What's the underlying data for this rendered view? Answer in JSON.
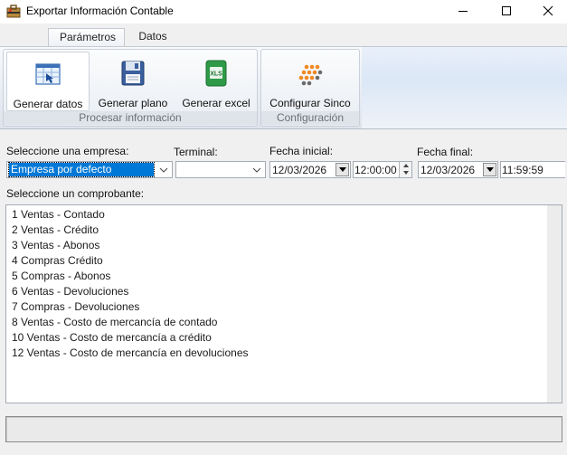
{
  "window": {
    "title": "Exportar Información Contable",
    "app_icon": "toolbox-icon",
    "controls": [
      "minimize-icon",
      "maximize-icon",
      "close-icon"
    ]
  },
  "ribbon": {
    "tabs": [
      {
        "label": "Parámetros",
        "active": true
      },
      {
        "label": "Datos",
        "active": false
      }
    ],
    "groups": [
      {
        "label": "Procesar información",
        "buttons": [
          {
            "label": "Generar datos",
            "icon": "spreadsheet-data-icon"
          },
          {
            "label": "Generar plano",
            "icon": "floppy-disk-icon"
          },
          {
            "label": "Generar excel",
            "icon": "xls-file-icon"
          }
        ]
      },
      {
        "label": "Configuración",
        "buttons": [
          {
            "label": "Configurar Sinco",
            "icon": "sinco-logo-icon"
          }
        ]
      }
    ]
  },
  "form": {
    "empresa_label": "Seleccione una empresa:",
    "empresa_value": "Empresa por defecto",
    "terminal_label": "Terminal:",
    "terminal_value": "",
    "fecha_inicial_label": "Fecha inicial:",
    "fecha_inicial_date": "12/03/2026",
    "fecha_inicial_time": "12:00:00",
    "fecha_final_label": "Fecha final:",
    "fecha_final_date": "12/03/2026",
    "fecha_final_time": "11:59:59",
    "comprobante_label": "Seleccione un comprobante:"
  },
  "comprobantes": [
    "1 Ventas - Contado",
    "2 Ventas - Crédito",
    "3 Ventas - Abonos",
    "4 Compras  Crédito",
    "5 Compras - Abonos",
    "6 Ventas - Devoluciones",
    "7 Compras - Devoluciones",
    "8 Ventas - Costo de mercancía de contado",
    "10 Ventas - Costo de mercancía a crédito",
    "12 Ventas - Costo de mercancía en devoluciones"
  ],
  "status": {
    "text": ""
  },
  "colors": {
    "selection": "#0078d7",
    "excel_green": "#2e9a48",
    "sinco_orange": "#f08a24"
  }
}
